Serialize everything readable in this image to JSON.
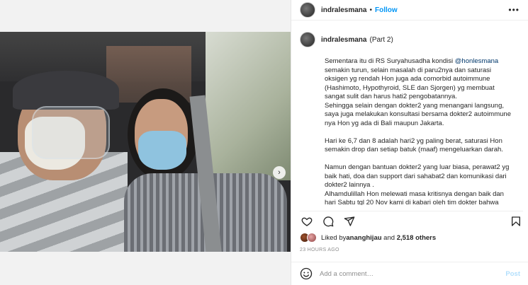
{
  "post": {
    "username": "indralesmana",
    "separator": "•",
    "follow_label": "Follow",
    "more_glyph": "•••"
  },
  "carousel": {
    "next_glyph": "›",
    "dot_count": 5,
    "active_dot": 1
  },
  "caption": {
    "username": "indralesmana",
    "part": "(Part 2)",
    "paragraph1_a": "Sementara itu di RS Suryahusadha kondisi ",
    "mention": "@honlesmana",
    "paragraph1_b": " semakin turun, selain masalah di paru2nya dan saturasi oksigen yg rendah Hon juga ada comorbid autoimmune (Hashimoto, Hypothyroid, SLE dan Sjorgen) yg membuat sangat sulit dan harus hati2 pengobatannya.",
    "paragraph2": "Sehingga selain dengan dokter2 yang menangani langsung, saya juga melakukan konsultasi bersama dokter2 autoimmune nya Hon yg ada di Bali maupun Jakarta.",
    "paragraph3": "Hari ke 6,7 dan 8 adalah hari2 yg paling berat, saturasi Hon semakin drop dan setiap batuk (maaf) mengeluarkan darah.",
    "paragraph4": "Namun dengan bantuan dokter2 yang luar biasa, perawat2 yg baik hati, doa dan support dari sahabat2 dan komunikasi dari dokter2 lainnya .",
    "paragraph5": "Alhamdulillah Hon melewati masa kritisnya dengan baik dan hari Sabtu tgl 20 Nov kami di kabari oleh tim dokter bahwa progress Hon sgt memungkinkan utk recovery rawat jalan. Insya Allah Selasa"
  },
  "likes": {
    "prefix": "Liked by ",
    "user": "ananghijau",
    "middle": " and ",
    "count": "2,518 others"
  },
  "timestamp": "23 HOURS AGO",
  "comment": {
    "placeholder": "Add a comment…",
    "post_label": "Post"
  },
  "colors": {
    "accent": "#0095f6",
    "post_disabled": "#b2dffc",
    "active_dot": "#3897f0"
  }
}
